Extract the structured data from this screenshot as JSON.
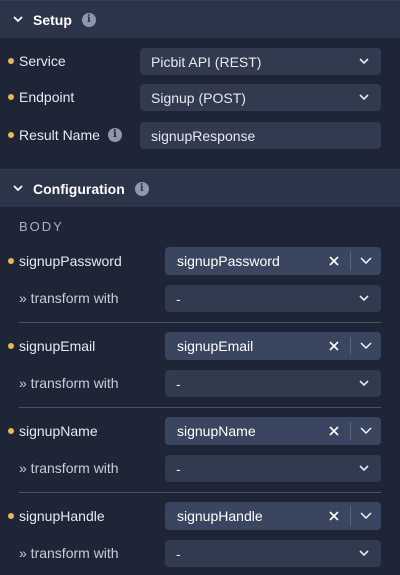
{
  "setup": {
    "title": "Setup",
    "info_icon": "i",
    "fields": {
      "service_label": "Service",
      "service_value": "Picbit API (REST)",
      "endpoint_label": "Endpoint",
      "endpoint_value": "Signup (POST)",
      "result_label": "Result Name",
      "result_value": "signupResponse"
    }
  },
  "configuration": {
    "title": "Configuration",
    "info_icon": "i",
    "body_label": "BODY",
    "transform_label": "» transform with",
    "transform_value": "-",
    "params": [
      {
        "label": "signupPassword",
        "value": "signupPassword"
      },
      {
        "label": "signupEmail",
        "value": "signupEmail"
      },
      {
        "label": "signupName",
        "value": "signupName"
      },
      {
        "label": "signupHandle",
        "value": "signupHandle"
      }
    ]
  },
  "colors": {
    "background": "#1e2536",
    "header": "#2b3448",
    "field": "#313a4f",
    "chip": "#3a4560",
    "required_dot": "#e9b659"
  },
  "icons": [
    "chevron-down-icon",
    "info-icon",
    "close-icon"
  ]
}
